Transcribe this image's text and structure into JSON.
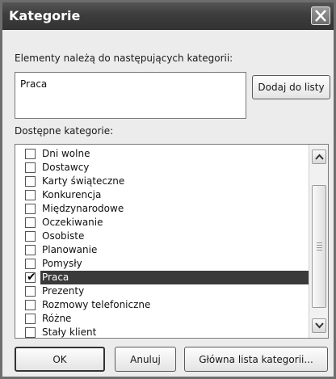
{
  "window": {
    "title": "Kategorie"
  },
  "assigned": {
    "label": "Elementy należą do następujących kategorii:",
    "value": "Praca",
    "add_button": "Dodaj do listy"
  },
  "available": {
    "label": "Dostępne kategorie:",
    "items": [
      {
        "label": "Dni wolne",
        "checked": false
      },
      {
        "label": "Dostawcy",
        "checked": false
      },
      {
        "label": "Karty świąteczne",
        "checked": false
      },
      {
        "label": "Konkurencja",
        "checked": false
      },
      {
        "label": "Międzynarodowe",
        "checked": false
      },
      {
        "label": "Oczekiwanie",
        "checked": false
      },
      {
        "label": "Osobiste",
        "checked": false
      },
      {
        "label": "Planowanie",
        "checked": false
      },
      {
        "label": "Pomysły",
        "checked": false
      },
      {
        "label": "Praca",
        "checked": true,
        "selected": true
      },
      {
        "label": "Prezenty",
        "checked": false
      },
      {
        "label": "Rozmowy telefoniczne",
        "checked": false
      },
      {
        "label": "Różne",
        "checked": false
      },
      {
        "label": "Stały klient",
        "checked": false
      }
    ]
  },
  "buttons": {
    "ok": "OK",
    "cancel": "Anuluj",
    "master": "Główna lista kategorii..."
  },
  "icons": {
    "close": "close-icon",
    "scroll_up": "chevron-up-icon",
    "scroll_down": "chevron-down-icon",
    "check": "checkmark-icon"
  },
  "colors": {
    "titlebar": "#3d3d3d",
    "selection": "#3a3a3a",
    "dialog_bg": "#ececec"
  }
}
